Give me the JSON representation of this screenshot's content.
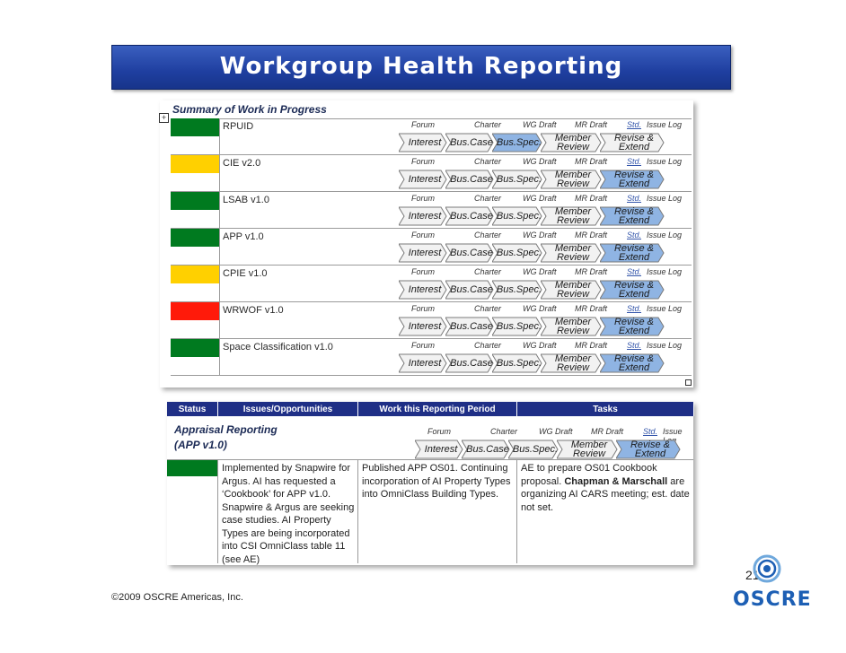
{
  "title": "Workgroup Health Reporting",
  "summary": {
    "heading": "Summary of Work in Progress",
    "stage_headers": [
      "Forum",
      "Charter",
      "WG Draft",
      "MR Draft",
      "Std.",
      "Issue Log"
    ],
    "workgroups": [
      {
        "name": "RPUID",
        "status": "green"
      },
      {
        "name": "CIE v2.0",
        "status": "yellow"
      },
      {
        "name": "LSAB v1.0",
        "status": "green"
      },
      {
        "name": "APP v1.0",
        "status": "green"
      },
      {
        "name": "CPIE v1.0",
        "status": "yellow"
      },
      {
        "name": "WRWOF v1.0",
        "status": "red"
      },
      {
        "name": "Space Classification v1.0",
        "status": "green"
      }
    ]
  },
  "detail": {
    "columns": [
      "Status",
      "Issues/Opportunities",
      "Work this Reporting Period",
      "Tasks"
    ],
    "name": "Appraisal Reporting",
    "sub": "(APP v1.0)",
    "status": "green",
    "issues": "Implemented by Snapwire for Argus.  AI has requested a ‘Cookbook’ for APP v1.0. Snapwire & Argus are seeking case studies.  AI Property Types are being incorporated into CSI OmniClass table 11 (see AE)",
    "work": "Published APP OS01. Continuing incorporation of AI Property Types into OmniClass Building Types.",
    "tasks_plain": "AE to prepare OS01 Cookbook proposal.  ",
    "tasks_bold": "Chapman & Marschall",
    "tasks_rest": " are organizing AI CARS meeting; est. date not set."
  },
  "stages": [
    {
      "key": "interest",
      "label": "Interest"
    },
    {
      "key": "bus_case",
      "label": "Bus.Case"
    },
    {
      "key": "bus_spec",
      "label": "Bus.Spec."
    },
    {
      "key": "member_review",
      "label": "Member\nReview"
    },
    {
      "key": "revise_extend",
      "label": "Revise &\nExtend"
    }
  ],
  "highlights": {
    "RPUID": "bus_spec",
    "default": "revise_extend"
  },
  "colors": {
    "green": "#007a1f",
    "yellow": "#ffd000",
    "red": "#ff1a0a",
    "chevron_fill": "#f2f2f2",
    "chevron_active": "#8fb4e3",
    "header_blue": "#1f2f86"
  },
  "page_number": "21",
  "copyright": "©2009 OSCRE Americas, Inc.",
  "logo": {
    "text": "OSCRE",
    "icon": "oscre-swirl-logo"
  }
}
